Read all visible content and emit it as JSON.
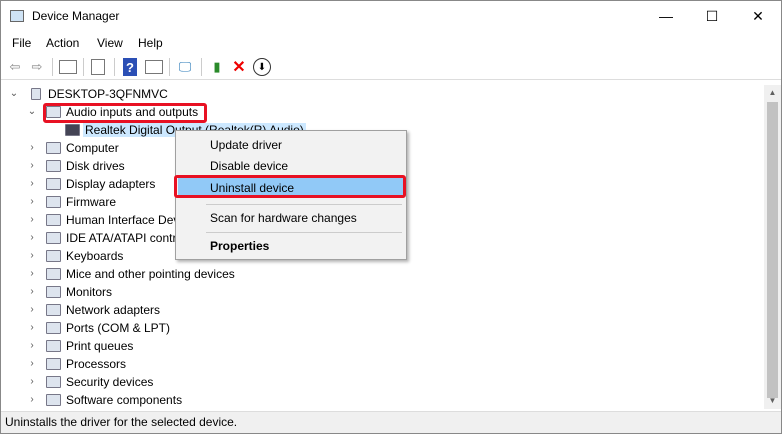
{
  "window": {
    "title": "Device Manager",
    "minimize": "—",
    "maximize": "☐",
    "close": "✕"
  },
  "menu": [
    "File",
    "Action",
    "View",
    "Help"
  ],
  "toolbar": [
    "back-icon",
    "forward-icon",
    "properties-icon",
    "update-icon",
    "help-icon",
    "run-icon",
    "scan-icon",
    "add-driver-icon",
    "uninstall-icon",
    "disable-icon"
  ],
  "tree": {
    "root": "DESKTOP-3QFNMVC",
    "categories": [
      {
        "label": "Audio inputs and outputs",
        "expanded": true,
        "children": [
          "Realtek Digital Output (Realtek(R) Audio)"
        ]
      },
      {
        "label": "Computer"
      },
      {
        "label": "Disk drives"
      },
      {
        "label": "Display adapters"
      },
      {
        "label": "Firmware"
      },
      {
        "label": "Human Interface Devices"
      },
      {
        "label": "IDE ATA/ATAPI controllers"
      },
      {
        "label": "Keyboards"
      },
      {
        "label": "Mice and other pointing devices"
      },
      {
        "label": "Monitors"
      },
      {
        "label": "Network adapters"
      },
      {
        "label": "Ports (COM & LPT)"
      },
      {
        "label": "Print queues"
      },
      {
        "label": "Processors"
      },
      {
        "label": "Security devices"
      },
      {
        "label": "Software components"
      }
    ]
  },
  "context_menu": {
    "items": [
      "Update driver",
      "Disable device",
      "Uninstall device",
      "Scan for hardware changes",
      "Properties"
    ],
    "highlighted": "Uninstall device"
  },
  "status": "Uninstalls the driver for the selected device.",
  "colors": {
    "highlight": "#91c9f7",
    "annotation": "#e81123",
    "selection": "#cce8ff"
  }
}
